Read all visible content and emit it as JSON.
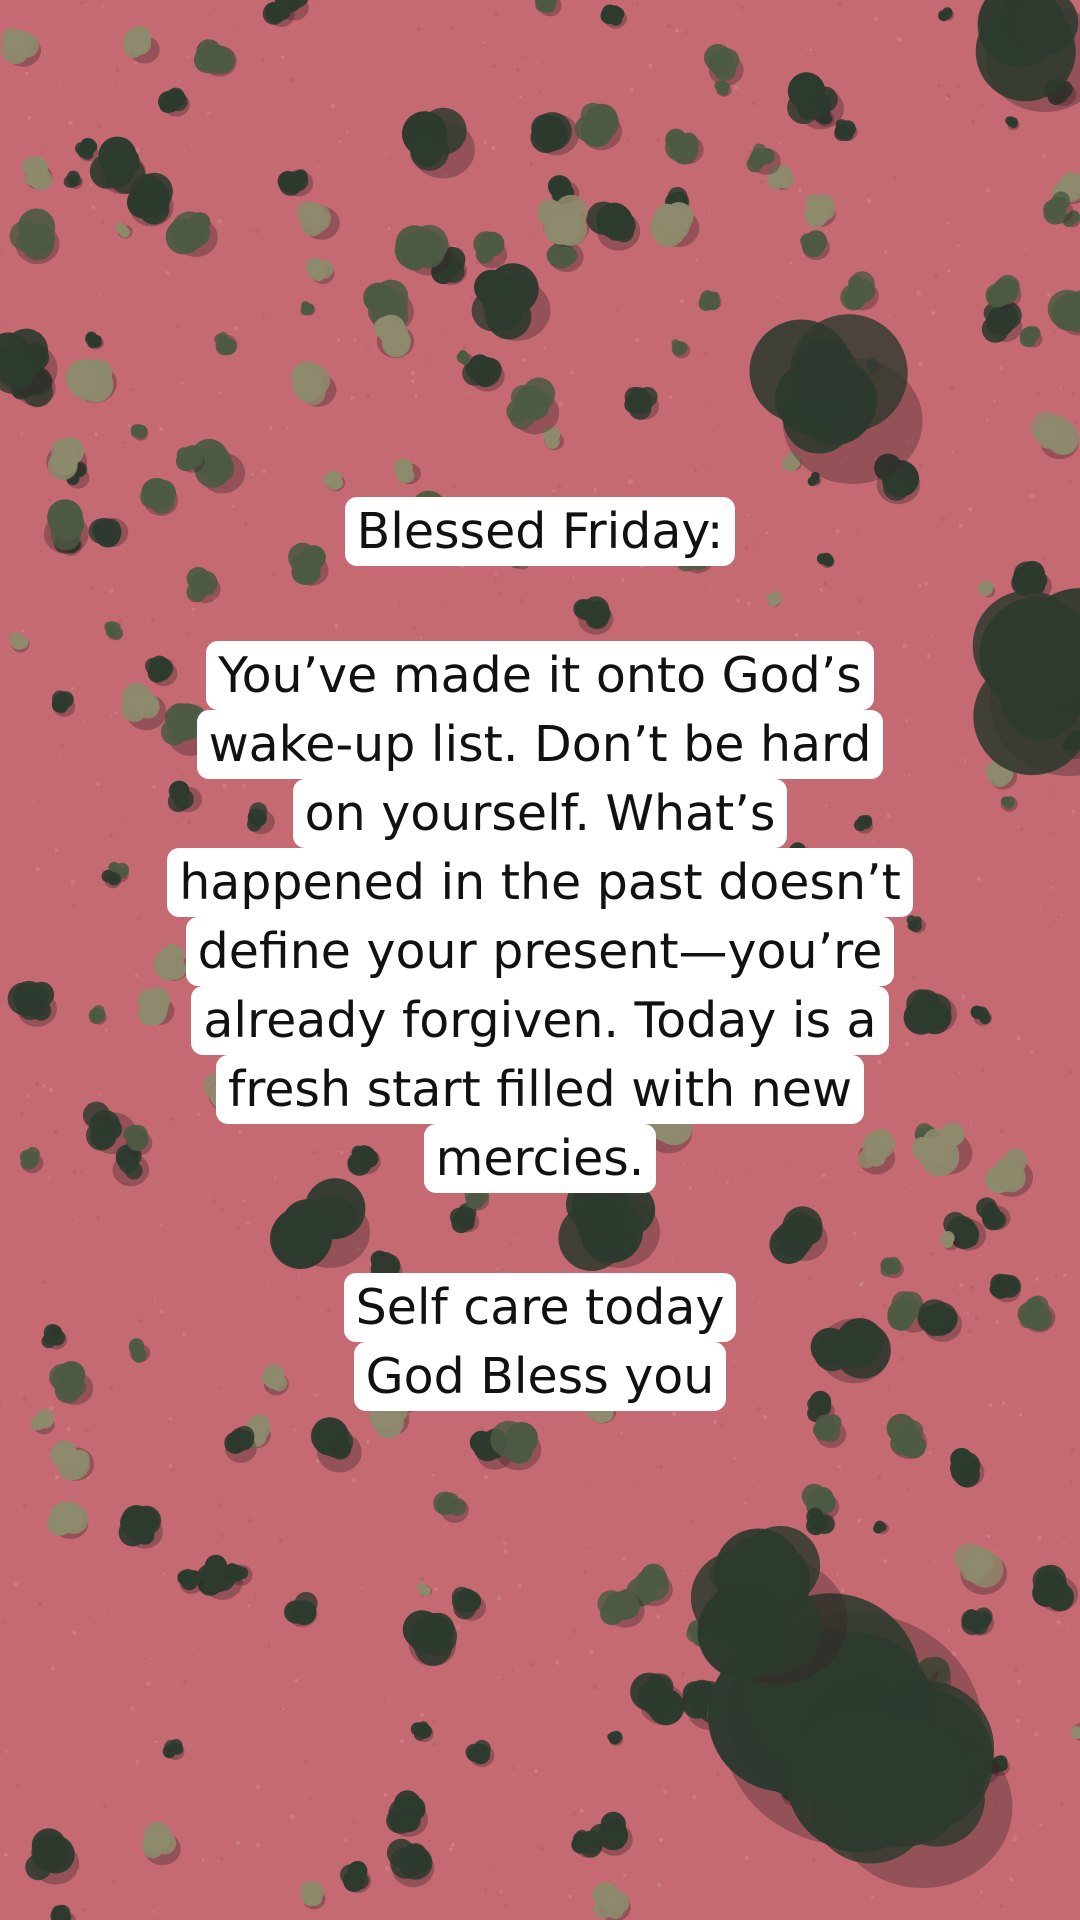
{
  "scene": {
    "description_icon": "aerial-desert-bushes",
    "colors": {
      "sand": "#c56a73",
      "sand_light": "#d68a90",
      "bush_dark": "#2d3a2e",
      "bush_mid": "#4d5a43",
      "bush_dry": "#8d8a6d",
      "caption_bg": "#ffffff",
      "caption_text": "#111111"
    }
  },
  "captions": {
    "heading": [
      "Blessed Friday:"
    ],
    "body": [
      "You’ve made it onto God’s",
      "wake-up list. Don’t be hard",
      "on yourself. What’s",
      "happened in the past doesn’t",
      "define your present—you’re",
      "already forgiven. Today is a",
      "fresh start filled with new",
      "mercies."
    ],
    "closing": [
      "Self care today",
      "God Bless you"
    ]
  }
}
